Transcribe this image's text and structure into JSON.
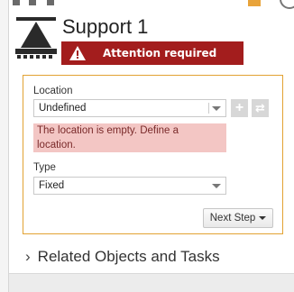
{
  "header": {
    "title": "Support 1",
    "attention_label": "Attention required"
  },
  "location": {
    "label": "Location",
    "value": "Undefined",
    "error": "The location is empty. Define a location.",
    "error_line1": "The location is empty. Define a",
    "error_line2": "location."
  },
  "type": {
    "label": "Type",
    "value": "Fixed"
  },
  "next_step_label": "Next Step",
  "related_label": "Related Objects and Tasks",
  "icons": {
    "support": "support-icon",
    "warning": "warning-icon",
    "add": "add-icon",
    "swap": "swap-icon"
  },
  "colors": {
    "attention_bg": "#a31d1d",
    "error_bg": "#f3c6c4",
    "form_border": "#e2a233"
  }
}
